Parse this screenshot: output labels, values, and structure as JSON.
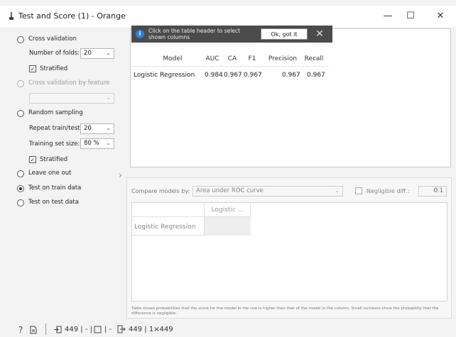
{
  "window": {
    "title": "Test and Score (1) - Orange",
    "minimize": "—",
    "maximize": "☐",
    "close": "✕"
  },
  "left_panel": {
    "cross_validation": "Cross validation",
    "number_of_folds_label": "Number of folds:",
    "number_of_folds_value": "20",
    "stratified_1": "Stratified",
    "cross_validation_by_feature": "Cross validation by feature",
    "random_sampling": "Random sampling",
    "repeat_train_test_label": "Repeat train/test:",
    "repeat_train_test_value": "20",
    "training_set_size_label": "Training set size:",
    "training_set_size_value": "80 %",
    "stratified_2": "Stratified",
    "leave_one_out": "Leave one out",
    "test_on_train_data": "Test on train data",
    "test_on_test_data": "Test on test data",
    "selected": "test_on_train_data"
  },
  "notification": {
    "text": "Click on the table header to select shown columns",
    "ok_label": "Ok, got it",
    "close": "✕",
    "icon": "info-icon"
  },
  "results_table": {
    "columns": [
      "Model",
      "AUC",
      "CA",
      "F1",
      "Precision",
      "Recall"
    ],
    "rows": [
      [
        "Logistic Regression",
        "0.984",
        "0.967",
        "0.967",
        "0.967",
        "0.967"
      ]
    ]
  },
  "compare": {
    "label": "Compare models by:",
    "value": "Area under ROC curve",
    "negligible_label": "Negligible diff.:",
    "negligible_value": "0.1",
    "column_header": "Logistic ...",
    "row_header": "Logistic Regression",
    "note": "Table shows probabilities that the score for the model in the row is higher than that of the model in the column. Small numbers show the probability that the difference is negligible."
  },
  "status_bar": {
    "help_icon": "help-icon",
    "report_icon": "report-icon",
    "input_icon": "input-icon",
    "input_text": "449 | - | ",
    "output_icon": "output-icon",
    "output_text": "449 | 1×449"
  },
  "colors": {
    "notification_bg": "#4b4b4b",
    "info_blue": "#2f7fd6",
    "window_bg": "#f3f3f3"
  }
}
